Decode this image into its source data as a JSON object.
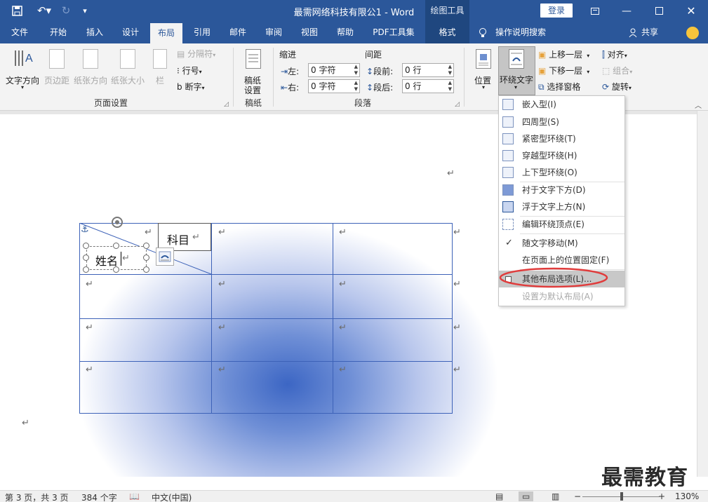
{
  "titlebar": {
    "title": "最需网络科技有限公1 - Word",
    "context_tool": "绘图工具",
    "login": "登录"
  },
  "tabs": [
    "文件",
    "开始",
    "插入",
    "设计",
    "布局",
    "引用",
    "邮件",
    "审阅",
    "视图",
    "帮助",
    "PDF工具集",
    "格式"
  ],
  "active_tab": "布局",
  "tell_me": "操作说明搜索",
  "share": "共享",
  "ribbon": {
    "page_setup": {
      "label": "页面设置",
      "text_direction": "文字方向",
      "margins": "页边距",
      "orientation": "纸张方向",
      "size": "纸张大小",
      "columns": "栏",
      "breaks": "分隔符",
      "line_numbers": "行号",
      "hyphenation": "断字"
    },
    "manuscript": {
      "label": "稿纸",
      "button": "稿纸\n设置"
    },
    "paragraph": {
      "label": "段落",
      "indent": "缩进",
      "spacing": "间距",
      "left_label": "左:",
      "left_value": "0 字符",
      "right_label": "右:",
      "right_value": "0 字符",
      "before_label": "段前:",
      "before_value": "0 行",
      "after_label": "段后:",
      "after_value": "0 行"
    },
    "arrange": {
      "position": "位置",
      "wrap_text": "环绕文字",
      "bring_forward": "上移一层",
      "send_backward": "下移一层",
      "selection_pane": "选择窗格",
      "align": "对齐",
      "group": "组合",
      "rotate": "旋转"
    }
  },
  "wrap_menu": {
    "items": [
      {
        "label": "嵌入型(I)",
        "icon": "wrap-inline-icon",
        "disabled": false
      },
      {
        "label": "四周型(S)",
        "icon": "wrap-square-icon",
        "disabled": false
      },
      {
        "label": "紧密型环绕(T)",
        "icon": "wrap-tight-icon",
        "disabled": false
      },
      {
        "label": "穿越型环绕(H)",
        "icon": "wrap-through-icon",
        "disabled": false
      },
      {
        "label": "上下型环绕(O)",
        "icon": "wrap-top-bottom-icon",
        "disabled": false
      },
      {
        "label": "衬于文字下方(D)",
        "icon": "behind-text-icon",
        "disabled": false
      },
      {
        "label": "浮于文字上方(N)",
        "icon": "in-front-of-text-icon",
        "disabled": false
      },
      {
        "label": "编辑环绕顶点(E)",
        "icon": "edit-wrap-points-icon",
        "disabled": false
      },
      {
        "label": "随文字移动(M)",
        "icon": "checkmark-icon",
        "disabled": false
      },
      {
        "label": "在页面上的位置固定(F)",
        "icon": "",
        "disabled": false
      },
      {
        "label": "其他布局选项(L)...",
        "icon": "layout-options-icon",
        "disabled": false
      },
      {
        "label": "设置为默认布局(A)",
        "icon": "",
        "disabled": true
      }
    ]
  },
  "document": {
    "textbox_subject": "科目",
    "textbox_name": "姓名",
    "paragraph_mark": "↵"
  },
  "statusbar": {
    "page": "第 3 页，共 3 页",
    "words": "384 个字",
    "language": "中文(中国)",
    "zoom": "130%"
  },
  "watermark": "最需教育",
  "colors": {
    "word_blue": "#2b579a",
    "highlight_red": "#e03c3c"
  }
}
